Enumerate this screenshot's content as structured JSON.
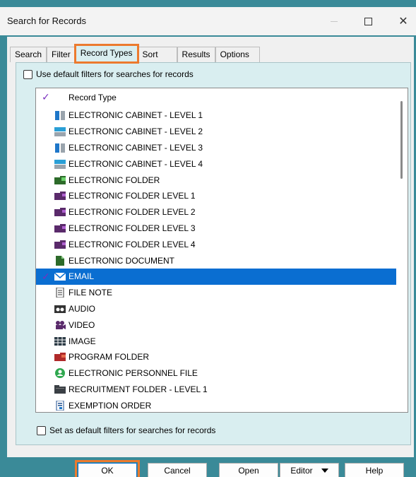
{
  "window": {
    "title": "Search for Records",
    "close_glyph": "✕"
  },
  "tabs": [
    {
      "label": "Search"
    },
    {
      "label": "Filter"
    },
    {
      "label": "Record Types",
      "active": true
    },
    {
      "label": "Sort"
    },
    {
      "label": "Results"
    },
    {
      "label": "Options"
    }
  ],
  "top_checkbox_label": "Use default filters for searches for records",
  "bottom_checkbox_label": "Set as default filters for searches for records",
  "list": {
    "header_check": "✓",
    "header_label": "Record Type",
    "items": [
      {
        "label": "ELECTRONIC CABINET - LEVEL 1",
        "icon": "cabinet-vertical-icon",
        "checked": false
      },
      {
        "label": "ELECTRONIC CABINET - LEVEL 2",
        "icon": "cabinet-horizontal-icon",
        "checked": false
      },
      {
        "label": "ELECTRONIC CABINET - LEVEL 3",
        "icon": "cabinet-vertical-icon",
        "checked": false
      },
      {
        "label": "ELECTRONIC CABINET - LEVEL 4",
        "icon": "cabinet-horizontal-icon",
        "checked": false
      },
      {
        "label": "ELECTRONIC FOLDER",
        "icon": "green-folder-icon",
        "checked": false
      },
      {
        "label": "ELECTRONIC FOLDER LEVEL 1",
        "icon": "purple-folder-icon",
        "checked": false
      },
      {
        "label": "ELECTRONIC FOLDER LEVEL 2",
        "icon": "purple-folder-icon",
        "checked": false
      },
      {
        "label": "ELECTRONIC FOLDER LEVEL 3",
        "icon": "purple-folder-icon",
        "checked": false
      },
      {
        "label": "ELECTRONIC FOLDER LEVEL 4",
        "icon": "purple-folder-icon",
        "checked": false
      },
      {
        "label": "ELECTRONIC DOCUMENT",
        "icon": "document-icon",
        "checked": false
      },
      {
        "label": "EMAIL",
        "icon": "envelope-icon",
        "checked": true,
        "selected": true
      },
      {
        "label": "FILE NOTE",
        "icon": "note-icon",
        "checked": false
      },
      {
        "label": "AUDIO",
        "icon": "audio-tape-icon",
        "checked": false
      },
      {
        "label": "VIDEO",
        "icon": "film-camera-icon",
        "checked": false
      },
      {
        "label": "IMAGE",
        "icon": "image-grid-icon",
        "checked": false
      },
      {
        "label": "PROGRAM FOLDER",
        "icon": "red-folder-icon",
        "checked": false
      },
      {
        "label": "ELECTRONIC PERSONNEL FILE",
        "icon": "person-circle-icon",
        "checked": false
      },
      {
        "label": "RECRUITMENT FOLDER - LEVEL 1",
        "icon": "dark-folder-icon",
        "checked": false
      },
      {
        "label": "EXEMPTION ORDER",
        "icon": "order-document-icon",
        "checked": false
      }
    ]
  },
  "buttons": {
    "ok": "OK",
    "cancel": "Cancel",
    "open": "Open",
    "editor": "Editor",
    "help": "Help"
  },
  "colors": {
    "accent_orange": "#ec7a2e",
    "selection_blue": "#0a6ed1",
    "check_purple": "#7a2fbf",
    "panel_bg": "#d9eef0",
    "window_teal": "#3a8a98"
  }
}
